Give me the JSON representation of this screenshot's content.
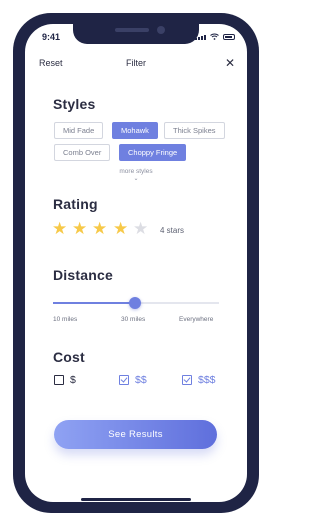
{
  "status_bar": {
    "time": "9:41"
  },
  "header": {
    "reset_label": "Reset",
    "title": "Filter",
    "close_icon": "close-icon"
  },
  "styles": {
    "heading": "Styles",
    "tags": [
      {
        "label": "Mid Fade",
        "selected": false
      },
      {
        "label": "Mohawk",
        "selected": true
      },
      {
        "label": "Thick Spikes",
        "selected": false
      },
      {
        "label": "Comb Over",
        "selected": false
      },
      {
        "label": "Choppy Fringe",
        "selected": true
      }
    ],
    "more_label": "more styles"
  },
  "rating": {
    "heading": "Rating",
    "value": 4,
    "max": 5,
    "label": "4 stars"
  },
  "distance": {
    "heading": "Distance",
    "labels": [
      "10 miles",
      "30 miles",
      "Everywhere"
    ],
    "selected": "30 miles"
  },
  "cost": {
    "heading": "Cost",
    "options": [
      {
        "label": "$",
        "checked": false
      },
      {
        "label": "$$",
        "checked": true
      },
      {
        "label": "$$$",
        "checked": true
      }
    ]
  },
  "cta": {
    "label": "See Results"
  },
  "colors": {
    "accent": "#6f80e0",
    "dark": "#1f2445",
    "star": "#f7c948",
    "text": "#2b2d42"
  }
}
